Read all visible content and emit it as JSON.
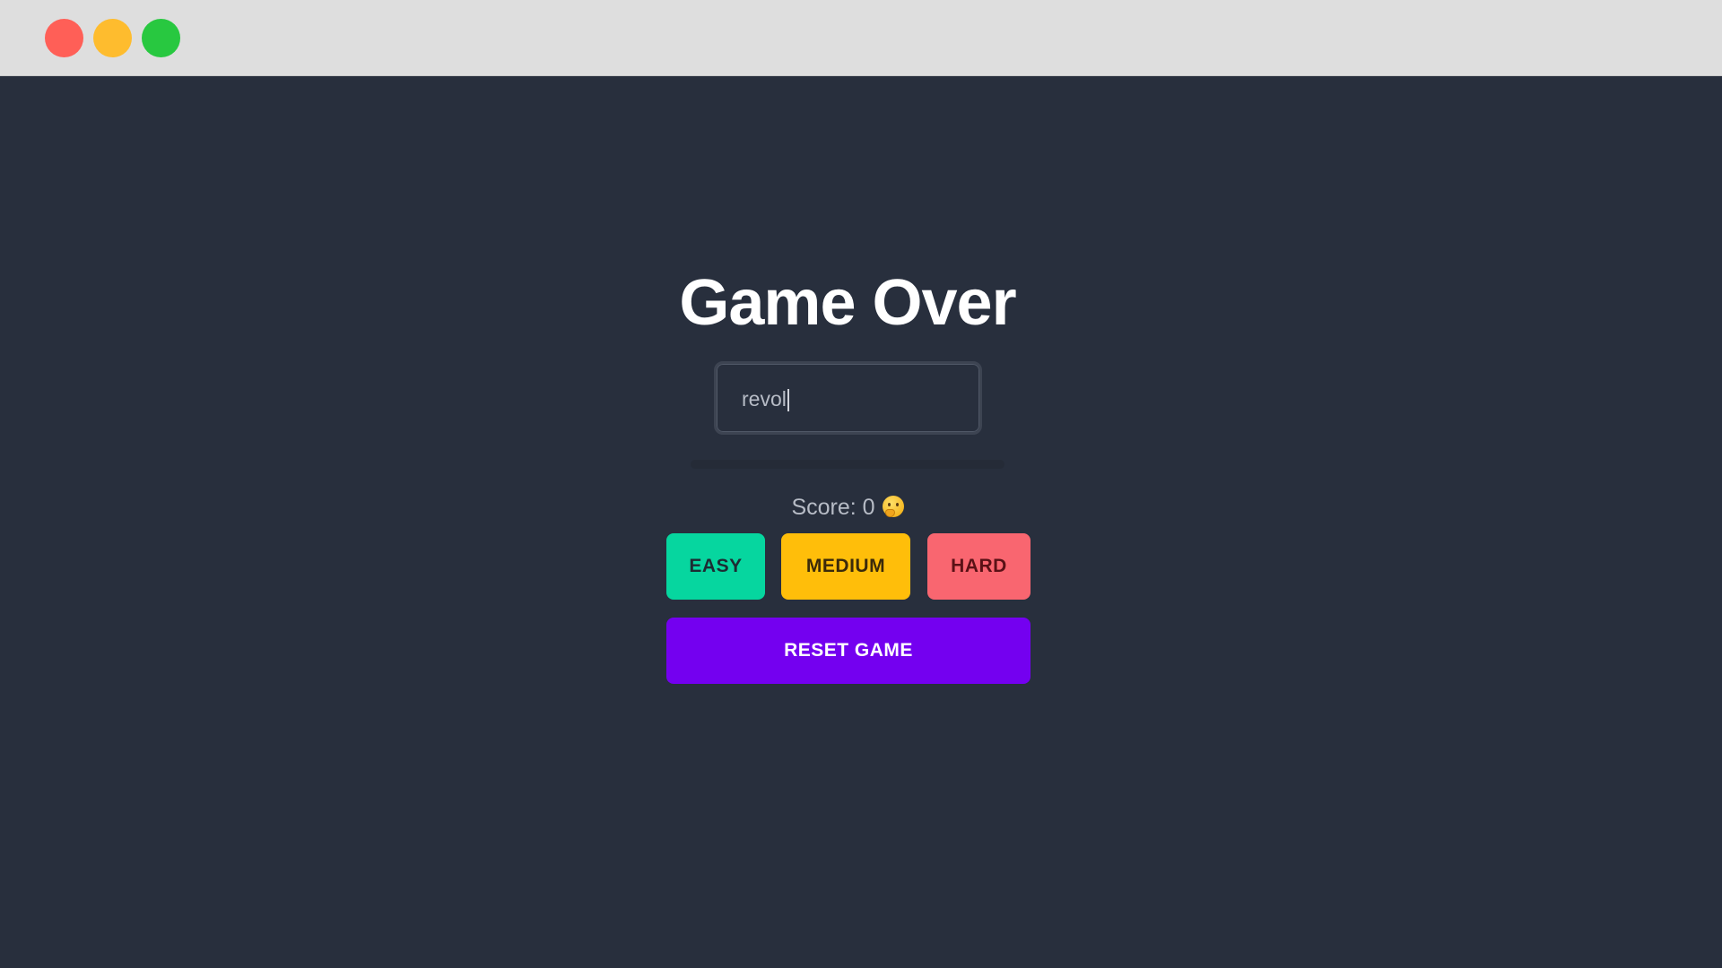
{
  "window": {
    "controls": [
      "close",
      "minimize",
      "maximize"
    ]
  },
  "game": {
    "title": "Game Over",
    "input_value": "revol",
    "score_text": "Score: 0",
    "score_emoji": "thinking-face-icon"
  },
  "difficulty": {
    "easy_label": "EASY",
    "medium_label": "MEDIUM",
    "hard_label": "HARD"
  },
  "actions": {
    "reset_label": "RESET GAME"
  },
  "colors": {
    "background": "#282f3d",
    "easy": "#06d69f",
    "medium": "#ffbe0a",
    "hard": "#f96670",
    "reset": "#7400f0"
  }
}
